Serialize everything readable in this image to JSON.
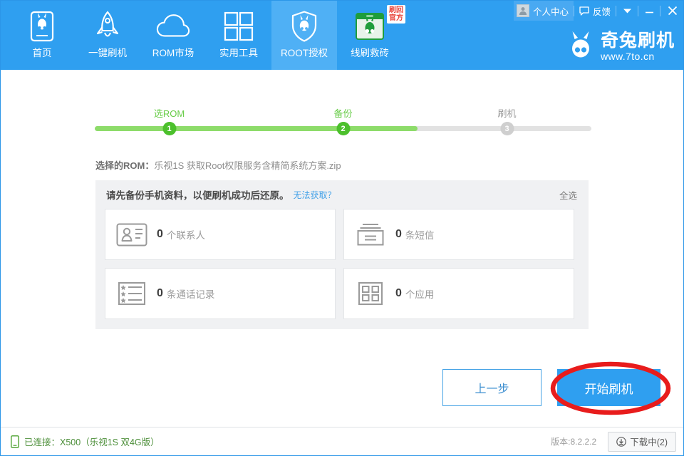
{
  "header": {
    "nav": [
      {
        "label": "首页",
        "icon": "phone-icon",
        "active": false
      },
      {
        "label": "一键刷机",
        "icon": "rocket-icon",
        "active": false
      },
      {
        "label": "ROM市场",
        "icon": "cloud-icon",
        "active": false
      },
      {
        "label": "实用工具",
        "icon": "grid-icon",
        "active": false
      },
      {
        "label": "ROOT授权",
        "icon": "shield-rabbit-icon",
        "active": true
      },
      {
        "label": "线刷救砖",
        "icon": "rabbit-box-icon",
        "active": false,
        "badge": "刷回\n官方"
      }
    ],
    "badge_line1": "刷回",
    "badge_line2": "官方",
    "user_center": "个人中心",
    "feedback": "反馈",
    "menu_icon": "chevron-down-icon",
    "minimize_icon": "minimize-icon",
    "close_icon": "close-icon",
    "brand_title": "奇兔刷机",
    "brand_url": "www.7to.cn",
    "accent_color": "#2f9ff0",
    "accent_active_color": "#4fb0f5"
  },
  "steps": {
    "items": [
      {
        "label": "选ROM",
        "num": "1",
        "state": "done"
      },
      {
        "label": "备份",
        "num": "2",
        "state": "done"
      },
      {
        "label": "刷机",
        "num": "3",
        "state": "todo"
      }
    ],
    "progress_percent": 65,
    "done_color": "#4cc02c",
    "track_color": "#e2e2e2",
    "fill_color": "#8ddc6a"
  },
  "rom": {
    "label": "选择的ROM：",
    "value": "乐视1S 获取Root权限服务含精简系统方案.zip"
  },
  "backup": {
    "title": "请先备份手机资料，以便刷机成功后还原。",
    "help_link": "无法获取？",
    "select_all": "全选",
    "items": [
      {
        "count": "0",
        "unit": "个联系人",
        "icon": "contact-card-icon"
      },
      {
        "count": "0",
        "unit": "条短信",
        "icon": "sms-icon"
      },
      {
        "count": "0",
        "unit": "条通话记录",
        "icon": "call-log-icon"
      },
      {
        "count": "0",
        "unit": "个应用",
        "icon": "apps-icon"
      }
    ]
  },
  "footer": {
    "prev_label": "上一步",
    "start_label": "开始刷机",
    "highlight_color": "#e81c1c"
  },
  "statusbar": {
    "connected_text": "已连接：X500（乐视1S 双4G版）",
    "device_icon": "phone-small-icon",
    "version": "版本:8.2.2.2",
    "download_label": "下载中(2)",
    "download_icon": "download-circle-icon"
  }
}
